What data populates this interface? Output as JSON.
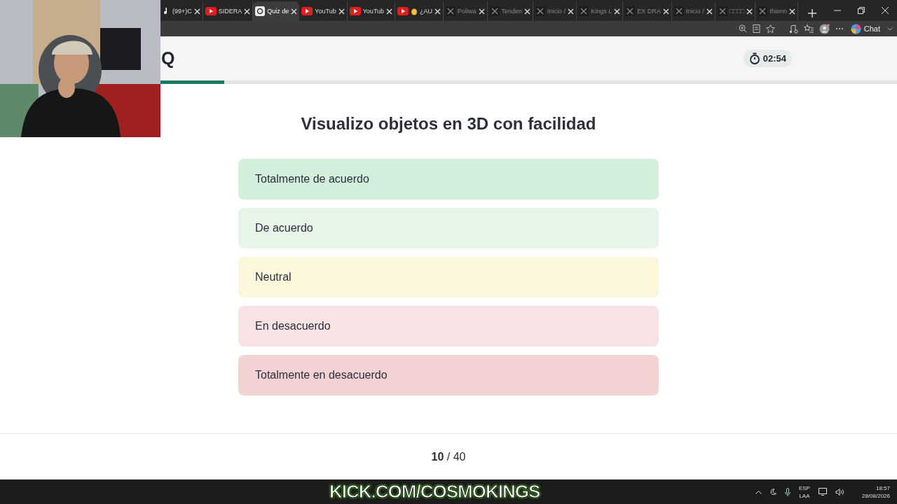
{
  "browser": {
    "tabs": [
      {
        "title": "(99+)C",
        "kind": "note",
        "selected": false
      },
      {
        "title": "SIDERA",
        "kind": "play",
        "selected": false
      },
      {
        "title": "Quiz de",
        "kind": "quiz",
        "selected": true
      },
      {
        "title": "YouTub",
        "kind": "play",
        "selected": false
      },
      {
        "title": "YouTub",
        "kind": "play",
        "selected": false
      },
      {
        "title": "¿AU",
        "kind": "play-hand",
        "selected": false
      },
      {
        "title": "Poliwa",
        "kind": "xmark",
        "selected": false
      },
      {
        "title": "Tenden",
        "kind": "xmark",
        "selected": false
      },
      {
        "title": "Inicio /",
        "kind": "xmark",
        "selected": false
      },
      {
        "title": "Kings L",
        "kind": "xmark",
        "selected": false
      },
      {
        "title": "EX DRA",
        "kind": "xmark",
        "selected": false
      },
      {
        "title": "Inicio /",
        "kind": "xmark",
        "selected": false
      },
      {
        "title": "□□□□",
        "kind": "xmark",
        "selected": false
      },
      {
        "title": "thienn",
        "kind": "xmark",
        "selected": false
      }
    ],
    "chat_button": "Chat"
  },
  "quiz": {
    "logo": "Q",
    "timer": "02:54",
    "progress": {
      "level": 0.25
    },
    "question": "Visualizo objetos en 3D con facilidad",
    "options": [
      {
        "label": "Totalmente de acuerdo",
        "color": "#d3eedb"
      },
      {
        "label": "De acuerdo",
        "color": "#e6f5e8"
      },
      {
        "label": "Neutral",
        "color": "#fcf7db"
      },
      {
        "label": "En desacuerdo",
        "color": "#f7e3e3"
      },
      {
        "label": "Totalmente en desacuerdo",
        "color": "#f2d2d3"
      }
    ],
    "counter": "**10** / 40"
  },
  "stream_overlay": "KICK.COM/COSMOKINGS",
  "taskbar": {
    "language": "ESP",
    "layout": "LAA",
    "time": "18:57",
    "date": "28/08/2026"
  }
}
